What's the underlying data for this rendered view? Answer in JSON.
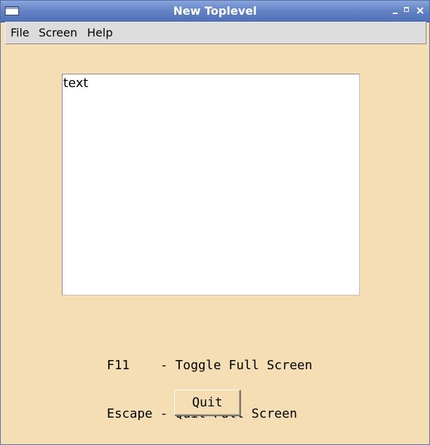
{
  "window": {
    "title": "New Toplevel"
  },
  "titlebar": {
    "icons": [
      "window-menu-icon",
      "minimize-icon",
      "maximize-icon",
      "close-icon"
    ]
  },
  "menubar": {
    "items": [
      {
        "label": "File"
      },
      {
        "label": "Screen"
      },
      {
        "label": "Help"
      }
    ]
  },
  "textbox": {
    "content": "text"
  },
  "help": {
    "lines": [
      "F11    - Toggle Full Screen",
      "Escape - Quit Full Screen"
    ]
  },
  "quit_button": {
    "label": "Quit"
  },
  "colors": {
    "background": "#f5deb3",
    "titlebar": "#6585c8",
    "menubar": "#dcdcdc",
    "textbox": "#ffffff"
  }
}
